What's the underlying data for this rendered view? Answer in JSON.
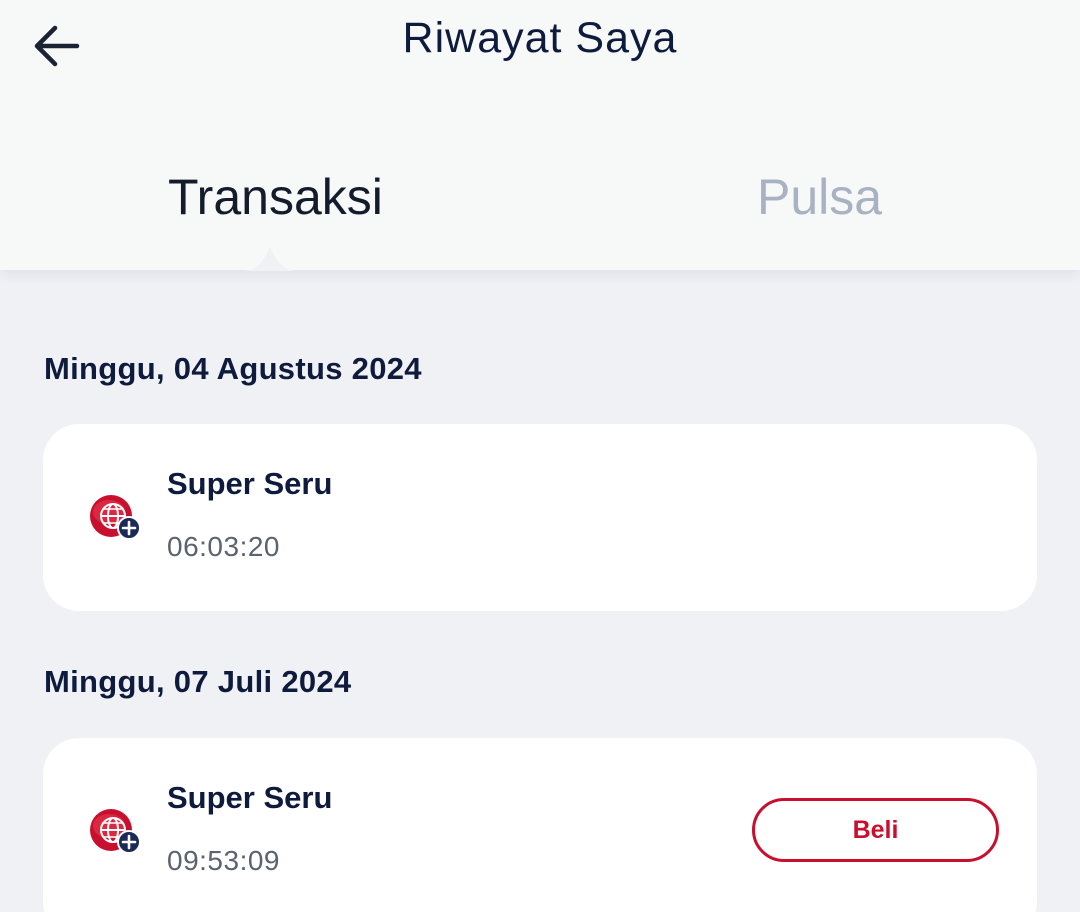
{
  "header": {
    "title": "Riwayat Saya",
    "back_icon": "arrow-left-icon"
  },
  "tabs": [
    {
      "label": "Transaksi",
      "active": true
    },
    {
      "label": "Pulsa",
      "active": false
    }
  ],
  "groups": [
    {
      "date": "Minggu, 04 Agustus 2024",
      "items": [
        {
          "name": "Super Seru",
          "time": "06:03:20",
          "icon": "globe-plus-icon",
          "action": null
        }
      ]
    },
    {
      "date": "Minggu, 07 Juli 2024",
      "items": [
        {
          "name": "Super Seru",
          "time": "09:53:09",
          "icon": "globe-plus-icon",
          "action": "Beli"
        }
      ]
    }
  ],
  "colors": {
    "header_bg": "#f7f9f9",
    "page_bg": "#eff1f5",
    "text_primary": "#0f1b3d",
    "tab_inactive": "#a9b2c3",
    "accent_red": "#c8102e",
    "badge_navy": "#1c2a57"
  }
}
